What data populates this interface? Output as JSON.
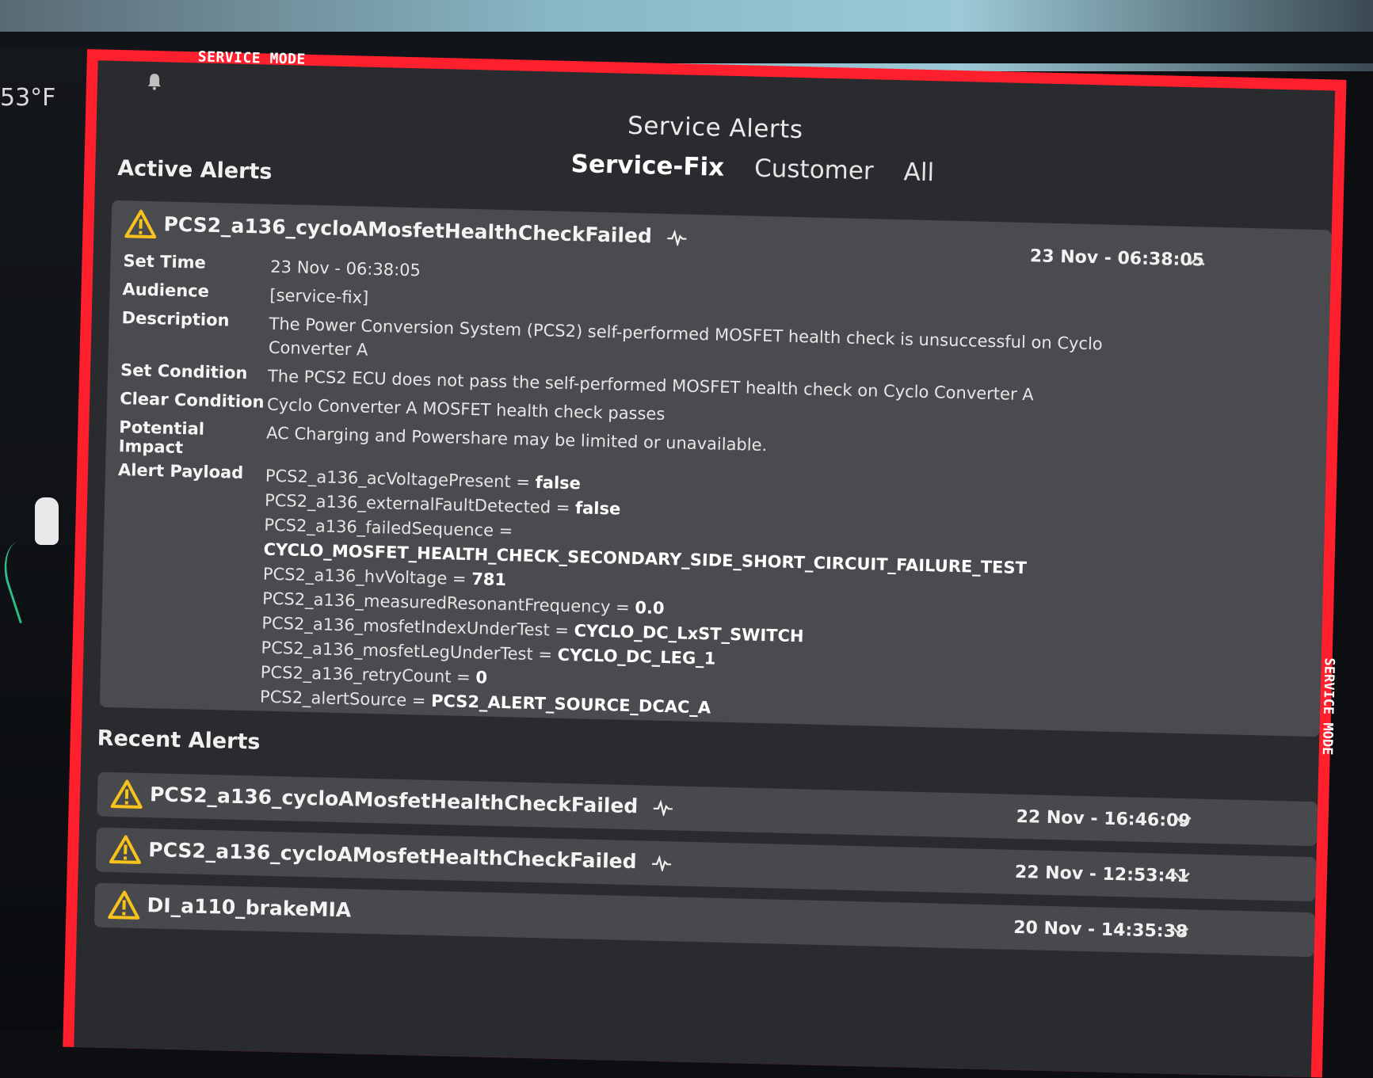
{
  "environment": {
    "temperature": "53°F"
  },
  "service_banner": {
    "top_label": "SERVICE MODE",
    "side_label": "SERVICE MODE"
  },
  "header": {
    "title": "Service Alerts",
    "tabs": [
      {
        "label": "Service-Fix",
        "active": true
      },
      {
        "label": "Customer",
        "active": false
      },
      {
        "label": "All",
        "active": false
      }
    ]
  },
  "active": {
    "heading": "Active Alerts",
    "alert": {
      "name": "PCS2_a136_cycloAMosfetHealthCheckFailed",
      "time": "23 Nov - 06:38:05",
      "details": [
        {
          "label": "Set Time",
          "value": "23 Nov - 06:38:05"
        },
        {
          "label": "Audience",
          "value": "[service-fix]"
        },
        {
          "label": "Description",
          "value": "The Power Conversion System (PCS2) self-performed MOSFET health check is unsuccessful on Cyclo Converter A"
        },
        {
          "label": "Set Condition",
          "value": "The PCS2 ECU does not pass the self-performed MOSFET health check on Cyclo Converter A"
        },
        {
          "label": "Clear Condition",
          "value": "Cyclo Converter A MOSFET health check passes"
        },
        {
          "label": "Potential Impact",
          "value": "AC Charging and Powershare may be limited or unavailable."
        }
      ],
      "payload_label": "Alert Payload",
      "payload": [
        {
          "key": "PCS2_a136_acVoltagePresent = ",
          "value": "false"
        },
        {
          "key": "PCS2_a136_externalFaultDetected = ",
          "value": "false"
        },
        {
          "key": "PCS2_a136_failedSequence = ",
          "value": ""
        },
        {
          "key": "",
          "value": "CYCLO_MOSFET_HEALTH_CHECK_SECONDARY_SIDE_SHORT_CIRCUIT_FAILURE_TEST"
        },
        {
          "key": "PCS2_a136_hvVoltage = ",
          "value": "781"
        },
        {
          "key": "PCS2_a136_measuredResonantFrequency = ",
          "value": "0.0"
        },
        {
          "key": "PCS2_a136_mosfetIndexUnderTest = ",
          "value": "CYCLO_DC_LxST_SWITCH"
        },
        {
          "key": "PCS2_a136_mosfetLegUnderTest = ",
          "value": "CYCLO_DC_LEG_1"
        },
        {
          "key": "PCS2_a136_retryCount = ",
          "value": "0"
        },
        {
          "key": "PCS2_alertSource = ",
          "value": "PCS2_ALERT_SOURCE_DCAC_A"
        }
      ]
    }
  },
  "recent": {
    "heading": "Recent Alerts",
    "alerts": [
      {
        "name": "PCS2_a136_cycloAMosfetHealthCheckFailed",
        "time": "22 Nov - 16:46:09",
        "pulse": true
      },
      {
        "name": "PCS2_a136_cycloAMosfetHealthCheckFailed",
        "time": "22 Nov - 12:53:41",
        "pulse": true
      },
      {
        "name": "DI_a110_brakeMIA",
        "time": "20 Nov - 14:35:38",
        "pulse": false
      }
    ]
  },
  "colors": {
    "service_red": "#ff1f2d",
    "warning_yellow": "#f6c21b",
    "panel": "#4a4b4f"
  },
  "icons": [
    "bell-icon",
    "warning-icon",
    "pulse-icon",
    "chevron-up-icon",
    "chevron-down-icon"
  ]
}
